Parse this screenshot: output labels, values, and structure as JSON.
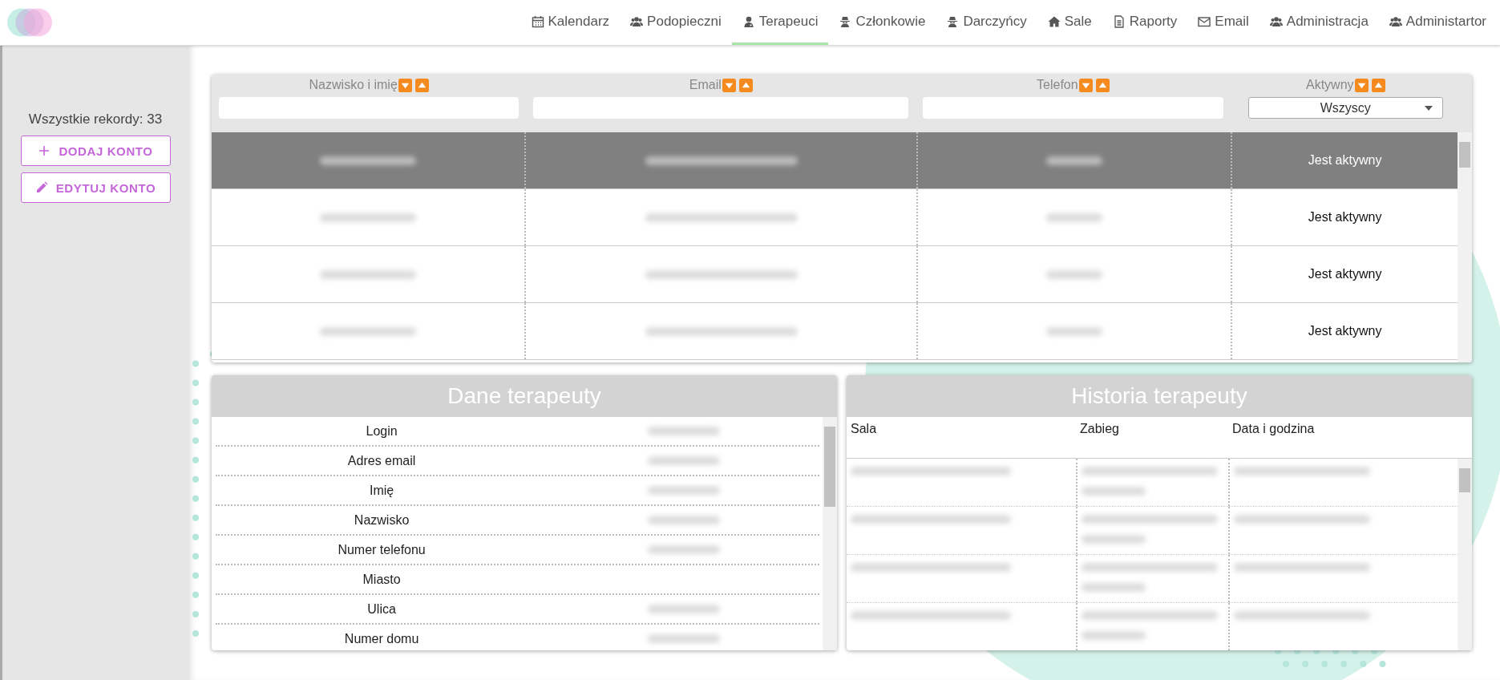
{
  "nav": {
    "items": [
      {
        "label": "Kalendarz",
        "kind": "calendar",
        "selected": false
      },
      {
        "label": "Podopieczni",
        "kind": "users",
        "selected": false
      },
      {
        "label": "Terapeuci",
        "kind": "doctor",
        "selected": true
      },
      {
        "label": "Członkowie",
        "kind": "spy",
        "selected": false
      },
      {
        "label": "Darczyńcy",
        "kind": "spy",
        "selected": false
      },
      {
        "label": "Sale",
        "kind": "home",
        "selected": false
      },
      {
        "label": "Raporty",
        "kind": "file",
        "selected": false
      },
      {
        "label": "Email",
        "kind": "mail",
        "selected": false
      },
      {
        "label": "Administracja",
        "kind": "users",
        "selected": false
      },
      {
        "label": "Administartor",
        "kind": "users",
        "selected": false
      }
    ]
  },
  "sidebar": {
    "record_count": "Wszystkie rekordy: 33",
    "buttons": [
      {
        "label": "DODAJ KONTO",
        "kind": "add"
      },
      {
        "label": "EDYTUJ KONTO",
        "kind": "edit"
      }
    ]
  },
  "table": {
    "columns": [
      {
        "label": "Nazwisko i imię",
        "kind": "text"
      },
      {
        "label": "Email",
        "kind": "text"
      },
      {
        "label": "Telefon",
        "kind": "text"
      },
      {
        "label": "Aktywny",
        "kind": "select",
        "value": "Wszyscy"
      }
    ],
    "rows": [
      {
        "selected": true,
        "status": "Jest aktywny"
      },
      {
        "selected": false,
        "status": "Jest aktywny"
      },
      {
        "selected": false,
        "status": "Jest aktywny"
      },
      {
        "selected": false,
        "status": "Jest aktywny"
      }
    ]
  },
  "details": {
    "title": "Dane terapeuty",
    "fields": [
      "Login",
      "Adres email",
      "Imię",
      "Nazwisko",
      "Numer telefonu",
      "Miasto",
      "Ulica",
      "Numer domu"
    ]
  },
  "history": {
    "title": "Historia terapeuty",
    "columns": [
      "Sala",
      "Zabieg",
      "Data i godzina"
    ]
  }
}
